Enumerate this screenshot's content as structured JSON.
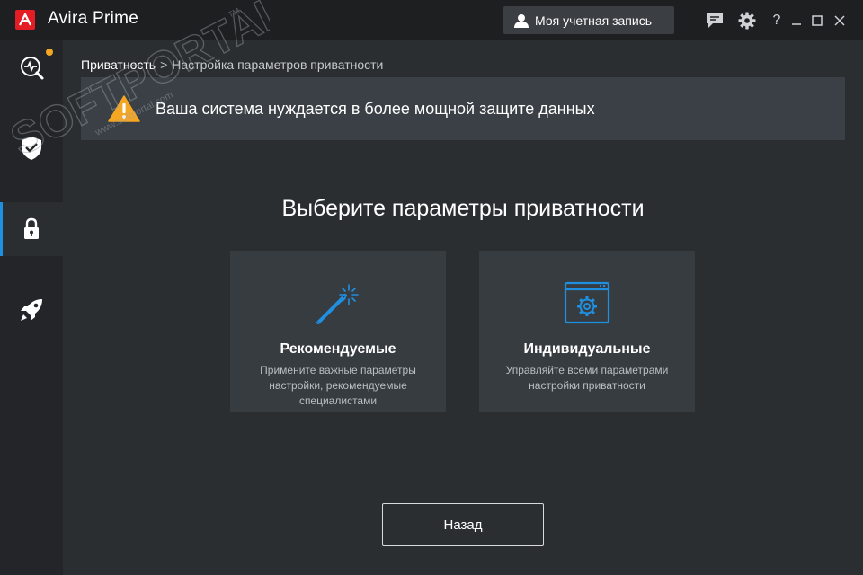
{
  "titlebar": {
    "app_name": "Avira Prime",
    "account_label": "Моя учетная запись",
    "help_glyph": "?",
    "icons": [
      "feedback-icon",
      "gear-icon",
      "help-icon",
      "minimize-icon",
      "maximize-icon",
      "close-icon"
    ]
  },
  "sidebar": {
    "items": [
      {
        "name": "status",
        "icon": "monitor-pulse-icon",
        "active": false,
        "notification": true
      },
      {
        "name": "security",
        "icon": "shield-icon",
        "active": false
      },
      {
        "name": "privacy",
        "icon": "lock-icon",
        "active": true
      },
      {
        "name": "performance",
        "icon": "rocket-icon",
        "active": false
      }
    ]
  },
  "breadcrumb": {
    "root": "Приватность",
    "separator": ">",
    "current": "Настройка параметров приватности"
  },
  "banner": {
    "icon": "warning-icon",
    "text": "Ваша система нуждается в более мощной защите данных"
  },
  "main": {
    "heading": "Выберите параметры приватности",
    "cards": [
      {
        "icon": "magic-wand-icon",
        "title": "Рекомендуемые",
        "description": "Примените важные параметры настройки, рекомендуемые специалистами"
      },
      {
        "icon": "settings-window-icon",
        "title": "Индивидуальные",
        "description": "Управляйте всеми параметрами настройки приватности"
      }
    ],
    "back_label": "Назад"
  },
  "watermark": {
    "text": "SOFTPORTAL",
    "url": "www.softportal.com",
    "tm": "TM"
  },
  "colors": {
    "accent": "#1f8fe0",
    "brand_red": "#e31d23",
    "warning": "#f5a623",
    "background": "#2b2e31",
    "titlebar": "#1d1f21",
    "sidebar": "#232528"
  }
}
